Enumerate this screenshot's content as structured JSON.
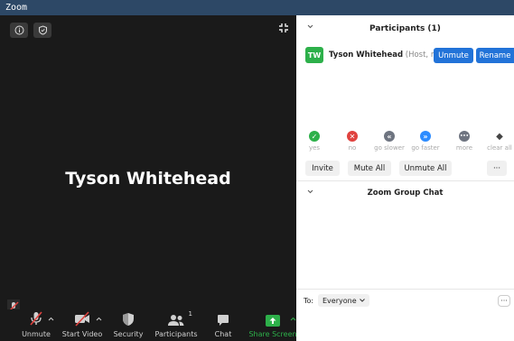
{
  "window": {
    "title": "Zoom"
  },
  "video": {
    "participant_name": "Tyson Whitehead"
  },
  "toolbar": {
    "items": [
      {
        "label": "Unmute",
        "icon": "muted-mic-icon"
      },
      {
        "label": "Start Video",
        "icon": "video-off-icon"
      },
      {
        "label": "Security",
        "icon": "shield-icon"
      },
      {
        "label": "Participants",
        "icon": "participants-icon",
        "count": "1"
      },
      {
        "label": "Chat",
        "icon": "chat-icon"
      },
      {
        "label": "Share Screen",
        "icon": "share-screen-icon",
        "color": "#2db04a"
      }
    ]
  },
  "participants": {
    "header": "Participants (1)",
    "list": [
      {
        "initials": "TW",
        "name": "Tyson Whitehead",
        "role": "(Host, me)",
        "unmute_label": "Unmute",
        "rename_label": "Rename"
      }
    ],
    "reactions": [
      {
        "label": "yes",
        "color": "#2db04a",
        "glyph": "✓"
      },
      {
        "label": "no",
        "color": "#e0423e",
        "glyph": "✕"
      },
      {
        "label": "go slower",
        "color": "#6e7480",
        "glyph": "«"
      },
      {
        "label": "go faster",
        "color": "#2d8cff",
        "glyph": "»"
      },
      {
        "label": "more",
        "color": "#6e7480",
        "glyph": "•••"
      },
      {
        "label": "clear all",
        "color": "#444",
        "glyph": "◆"
      }
    ],
    "actions": {
      "invite": "Invite",
      "mute_all": "Mute All",
      "unmute_all": "Unmute All",
      "more": "···"
    }
  },
  "chat": {
    "header": "Zoom Group Chat",
    "to_label": "To:",
    "recipient": "Everyone",
    "more": "···"
  },
  "colors": {
    "accent": "#2273d8",
    "titlebar": "#2d4866",
    "video_bg": "#1a1a1a"
  }
}
